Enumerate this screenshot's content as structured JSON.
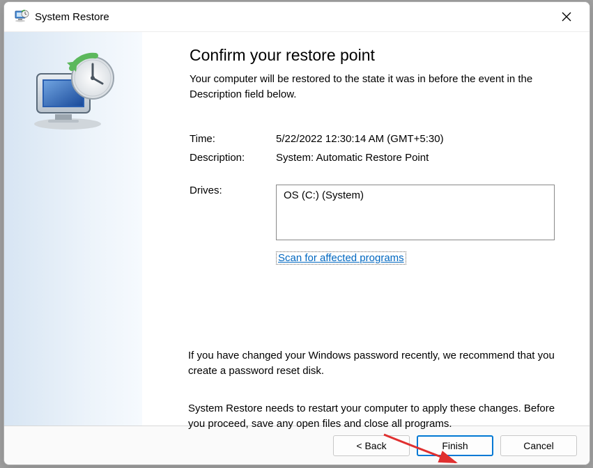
{
  "titlebar": {
    "title": "System Restore"
  },
  "content": {
    "heading": "Confirm your restore point",
    "subheading": "Your computer will be restored to the state it was in before the event in the Description field below.",
    "time_label": "Time:",
    "time_value": "5/22/2022 12:30:14 AM (GMT+5:30)",
    "description_label": "Description:",
    "description_value": "System: Automatic Restore Point",
    "drives_label": "Drives:",
    "drives_value": "OS (C:) (System)",
    "scan_link": "Scan for affected programs",
    "note_password": "If you have changed your Windows password recently, we recommend that you create a password reset disk.",
    "note_restart": "System Restore needs to restart your computer to apply these changes. Before you proceed, save any open files and close all programs."
  },
  "buttons": {
    "back": "< Back",
    "finish": "Finish",
    "cancel": "Cancel"
  }
}
